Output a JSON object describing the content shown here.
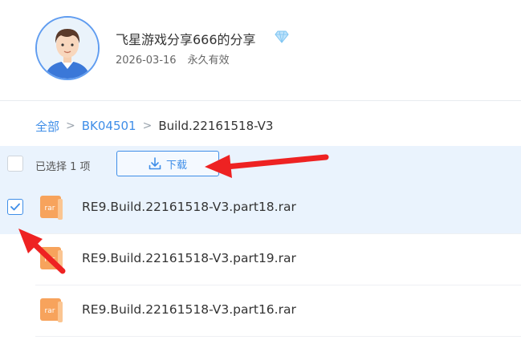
{
  "share": {
    "title": "飞星游戏分享666的分享",
    "date": "2026-03-16",
    "validity": "永久有效"
  },
  "breadcrumb": {
    "root": "全部",
    "folder": "BK04501",
    "current": "Build.22161518-V3",
    "separator": ">"
  },
  "toolbar": {
    "selected_text": "已选择 1 项",
    "download_label": "下载",
    "select_all_checked": false
  },
  "files": [
    {
      "name": "RE9.Build.22161518-V3.part18.rar",
      "type": "rar",
      "checked": true
    },
    {
      "name": "RE9.Build.22161518-V3.part19.rar",
      "type": "rar",
      "checked": false
    },
    {
      "name": "RE9.Build.22161518-V3.part16.rar",
      "type": "rar",
      "checked": false
    }
  ],
  "colors": {
    "accent": "#3f8ee8",
    "selected_bg": "#eaf3fd",
    "rar_icon": "#f7a35c",
    "annotation_arrow": "#ee2222"
  },
  "icons": {
    "avatar": "user-avatar",
    "badge": "diamond-icon",
    "download": "download-icon",
    "file": "rar-file-icon",
    "check": "check-icon"
  }
}
